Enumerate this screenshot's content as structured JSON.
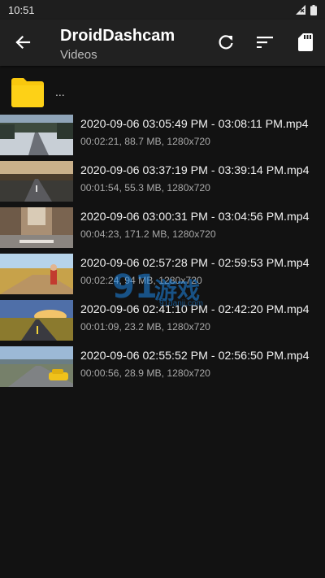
{
  "status": {
    "time": "10:51"
  },
  "appbar": {
    "title": "DroidDashcam",
    "subtitle": "Videos"
  },
  "parent": {
    "label": "..."
  },
  "videos": [
    {
      "title": "2020-09-06 03:05:49 PM - 03:08:11 PM.mp4",
      "meta": "00:02:21, 88.7 MB, 1280x720"
    },
    {
      "title": "2020-09-06 03:37:19 PM - 03:39:14 PM.mp4",
      "meta": "00:01:54, 55.3 MB, 1280x720"
    },
    {
      "title": "2020-09-06 03:00:31 PM - 03:04:56 PM.mp4",
      "meta": "00:04:23, 171.2 MB, 1280x720"
    },
    {
      "title": "2020-09-06 02:57:28 PM - 02:59:53 PM.mp4",
      "meta": "00:02:24, 94 MB, 1280x720"
    },
    {
      "title": "2020-09-06 02:41:10 PM - 02:42:20 PM.mp4",
      "meta": "00:01:09, 23.2 MB, 1280x720"
    },
    {
      "title": "2020-09-06 02:55:52 PM - 02:56:50 PM.mp4",
      "meta": "00:00:56, 28.9 MB, 1280x720"
    }
  ],
  "watermark": {
    "number": "91",
    "text": "游戏",
    "url": "91danji.com"
  },
  "icons": {
    "back": "arrow-back-icon",
    "refresh": "refresh-icon",
    "sort": "sort-icon",
    "sd_card": "sd-card-icon",
    "folder": "folder-icon"
  },
  "colors": {
    "background": "#121212",
    "appbar": "#212121",
    "folder": "#f9c80e"
  }
}
